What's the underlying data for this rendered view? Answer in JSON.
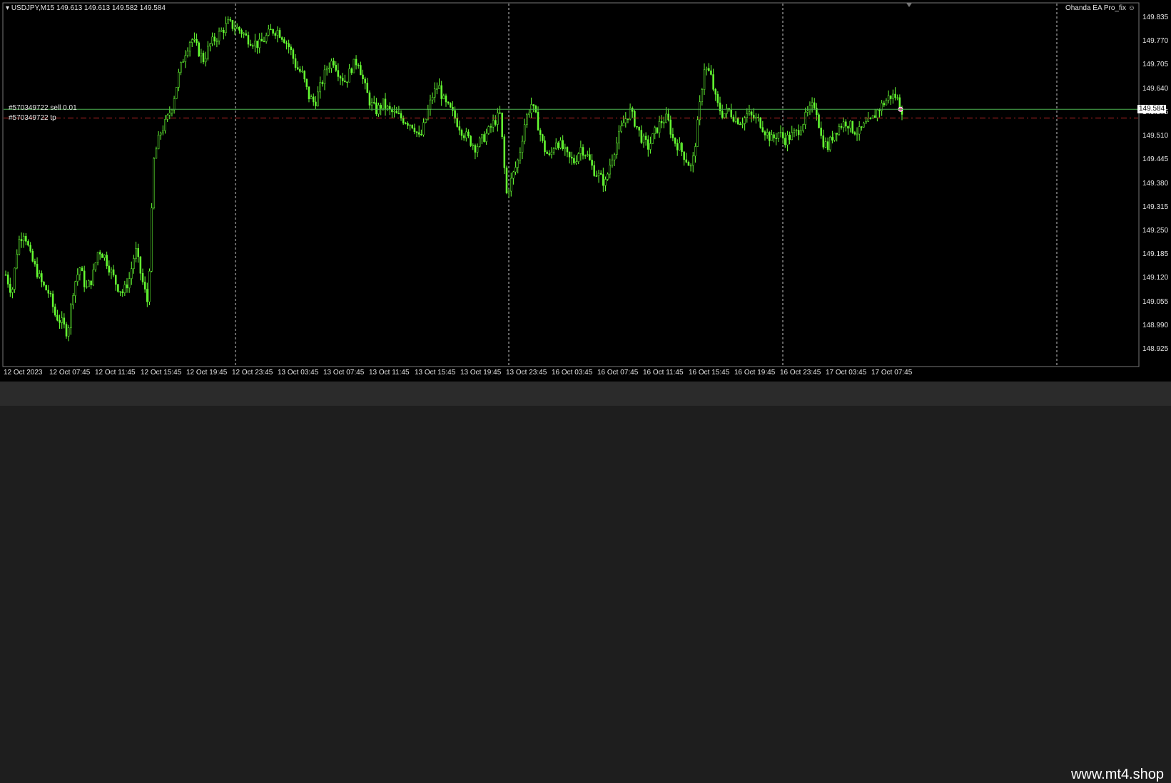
{
  "chart": {
    "symbol_header": "USDJPY,M15  149.613 149.613 149.582 149.584",
    "ea_name": "Ohanda EA Pro_fix",
    "current_price": "149.584",
    "order_label": "#570349722 sell 0.01",
    "tp_label": "#570349722 tp",
    "price_ticks": [
      "149.835",
      "149.770",
      "149.705",
      "149.640",
      "149.575",
      "149.510",
      "149.445",
      "149.380",
      "149.315",
      "149.250",
      "149.185",
      "149.120",
      "149.055",
      "148.990",
      "148.925"
    ],
    "time_ticks": [
      "12 Oct 2023",
      "12 Oct 07:45",
      "12 Oct 11:45",
      "12 Oct 15:45",
      "12 Oct 19:45",
      "12 Oct 23:45",
      "13 Oct 03:45",
      "13 Oct 07:45",
      "13 Oct 11:45",
      "13 Oct 15:45",
      "13 Oct 19:45",
      "13 Oct 23:45",
      "16 Oct 03:45",
      "16 Oct 07:45",
      "16 Oct 11:45",
      "16 Oct 15:45",
      "16 Oct 19:45",
      "16 Oct 23:45",
      "17 Oct 03:45",
      "17 Oct 07:45"
    ],
    "colors": {
      "background": "#000000",
      "candle": "#66ff33",
      "grid": "#c8c8c8",
      "order_line": "#4caf50",
      "tp_line": "#c62828"
    }
  },
  "chart_data": {
    "type": "line",
    "series": [
      {
        "values": [
          149.13,
          149.08,
          149.22,
          149.25,
          149.18,
          149.14,
          149.1,
          149.08,
          149.02,
          149.0,
          148.97,
          149.1,
          149.15,
          149.09,
          149.12,
          149.2,
          149.18,
          149.14,
          149.1,
          149.08,
          149.12,
          149.2,
          149.12,
          149.05,
          149.45,
          149.52,
          149.55,
          149.6,
          149.68,
          149.74,
          149.78,
          149.75,
          149.72,
          149.76,
          149.78,
          149.8,
          149.82,
          149.81,
          149.8,
          149.78,
          149.77,
          149.76,
          149.78,
          149.8,
          149.8,
          149.78,
          149.75,
          149.7,
          149.68,
          149.62,
          149.6,
          149.65,
          149.7,
          149.72,
          149.68,
          149.66,
          149.7,
          149.72,
          149.65,
          149.6,
          149.58,
          149.6,
          149.58,
          149.57,
          149.56,
          149.55,
          149.54,
          149.5,
          149.56,
          149.62,
          149.65,
          149.6,
          149.58,
          149.55,
          149.52,
          149.5,
          149.48,
          149.5,
          149.52,
          149.55,
          149.57,
          149.35,
          149.4,
          149.45,
          149.55,
          149.6,
          149.55,
          149.48,
          149.45,
          149.5,
          149.48,
          149.45,
          149.44,
          149.48,
          149.46,
          149.42,
          149.4,
          149.38,
          149.45,
          149.5,
          149.55,
          149.58,
          149.54,
          149.5,
          149.48,
          149.52,
          149.55,
          149.56,
          149.5,
          149.48,
          149.45,
          149.42,
          149.55,
          149.7,
          149.68,
          149.6,
          149.57,
          149.58,
          149.56,
          149.55,
          149.57,
          149.56,
          149.55,
          149.52,
          149.5,
          149.52,
          149.5,
          149.51,
          149.52,
          149.55,
          149.58,
          149.6,
          149.5,
          149.48,
          149.52,
          149.54,
          149.55,
          149.53,
          149.52,
          149.54,
          149.55,
          149.58,
          149.6,
          149.62,
          149.62,
          149.584
        ]
      }
    ],
    "x_labels": [
      "12 Oct 2023",
      "12 Oct 07:45",
      "12 Oct 11:45",
      "12 Oct 15:45",
      "12 Oct 19:45",
      "12 Oct 23:45",
      "13 Oct 03:45",
      "13 Oct 07:45",
      "13 Oct 11:45",
      "13 Oct 15:45",
      "13 Oct 19:45",
      "13 Oct 23:45",
      "16 Oct 03:45",
      "16 Oct 07:45",
      "16 Oct 11:45",
      "16 Oct 15:45",
      "16 Oct 19:45",
      "16 Oct 23:45",
      "17 Oct 03:45",
      "17 Oct 07:45"
    ],
    "ylim": [
      148.925,
      149.835
    ],
    "grid": false,
    "order_price": 149.584,
    "tp_price": 149.56
  },
  "footer": {
    "watermark": "www.mt4.shop"
  }
}
